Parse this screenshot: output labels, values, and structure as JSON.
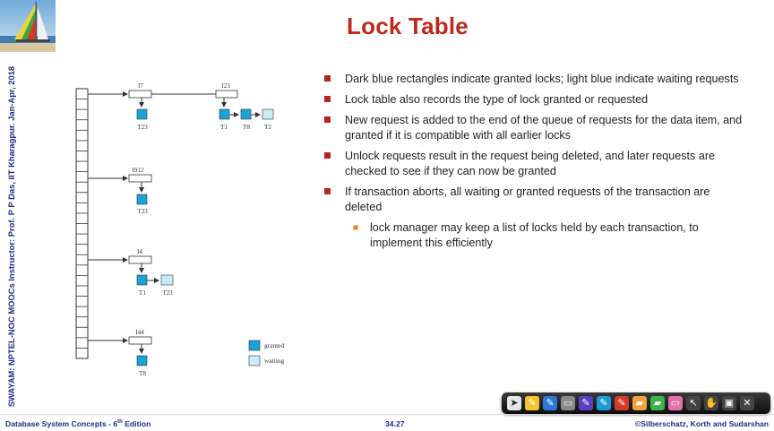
{
  "slide": {
    "title": "Lock Table",
    "side_credit": "SWAYAM: NPTEL-NOC MOOCs Instructor: Prof. P P Das, IIT Kharagpur. Jan-Apr, 2018",
    "bullets": [
      "Dark blue rectangles indicate granted locks; light blue indicate waiting requests",
      "Lock table also records the type of lock granted or requested",
      "New request is added to the end of the queue of requests for the data item, and granted if it is compatible with all earlier locks",
      "Unlock requests result in the request being deleted, and later requests are checked to see if they can now be granted",
      "If transaction aborts, all waiting or granted requests of the transaction are deleted"
    ],
    "sub_bullets": [
      "lock manager may keep a list of locks held by each transaction, to implement this efficiently"
    ],
    "diagram": {
      "items": [
        "I7",
        "I23",
        "I912",
        "I4",
        "I44"
      ],
      "transactions": {
        "i7_t23": "T23",
        "i23_t1": "T1",
        "i23_t8": "T8",
        "i23_t2": "T2",
        "i912_t23": "T23",
        "i4_t1": "T1",
        "i4_t23": "T23",
        "i44_t8": "T8"
      },
      "legend": {
        "granted": "granted",
        "waiting": "waiting"
      },
      "colors": {
        "granted": "#1aa3d8",
        "waiting": "#c9ecf8",
        "line": "#333333"
      }
    },
    "footer": {
      "left_main": "Database System Concepts - 6",
      "left_sup": "th",
      "left_tail": " Edition",
      "center": "34.27",
      "right": "©Silberschatz, Korth and Sudarshan"
    },
    "toolbar_icons": [
      "arrow-icon",
      "pen-icon",
      "pen-icon",
      "eraser-icon",
      "pen-icon",
      "pen-icon",
      "pen-icon",
      "highlighter-icon",
      "highlighter-icon",
      "eraser-icon",
      "pointer-icon",
      "hand-icon",
      "screen-icon",
      "close-icon"
    ],
    "accent_colors": {
      "title": "#c0281c",
      "footer": "#1e2b8c",
      "bullet": "#b3261e",
      "sub_bullet": "#f08a24"
    }
  }
}
